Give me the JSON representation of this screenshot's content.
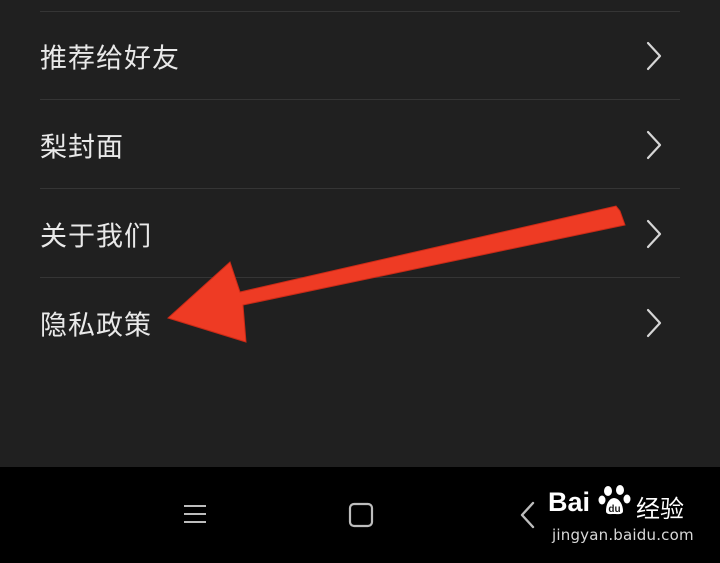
{
  "menu": {
    "items": [
      {
        "label": "推荐给好友"
      },
      {
        "label": "梨封面"
      },
      {
        "label": "关于我们"
      },
      {
        "label": "隐私政策"
      }
    ]
  },
  "icons": {
    "row_chevron": "chevron-right-icon",
    "nav_menu": "hamburger-menu-icon",
    "nav_home": "square-home-icon",
    "nav_back": "chevron-left-back-icon",
    "annotation": "red-arrow-pointer"
  },
  "colors": {
    "panel_background": "#202020",
    "nav_background": "#000000",
    "label_text": "#e9e9e9",
    "divider": "#353535",
    "arrow": "#ee3b24"
  },
  "watermark": {
    "brand": "Bai",
    "suffix": "经验",
    "url": "jingyan.baidu.com"
  }
}
